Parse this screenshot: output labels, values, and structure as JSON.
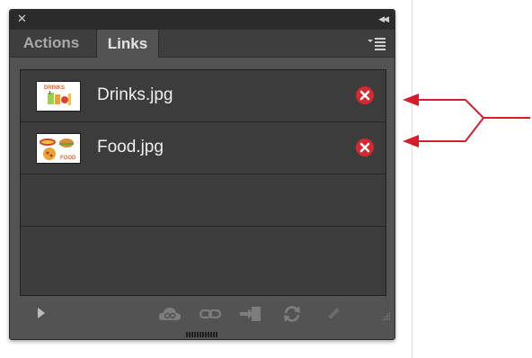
{
  "panel": {
    "tabs": [
      {
        "label": "Actions",
        "active": false
      },
      {
        "label": "Links",
        "active": true
      }
    ]
  },
  "links": [
    {
      "name": "Drinks.jpg",
      "status": "missing",
      "thumbnail": "drinks-thumbnail"
    },
    {
      "name": "Food.jpg",
      "status": "missing",
      "thumbnail": "food-thumbnail"
    }
  ],
  "toolbar": {
    "icons": [
      "show-link-info-icon",
      "cc-libraries-icon",
      "relink-icon",
      "go-to-link-icon",
      "update-link-icon",
      "edit-original-icon"
    ]
  },
  "colors": {
    "panel_bg": "#535353",
    "list_bg": "#3c3c3c",
    "missing_badge": "#d7272f",
    "annotation_arrow": "#d11f2c"
  }
}
